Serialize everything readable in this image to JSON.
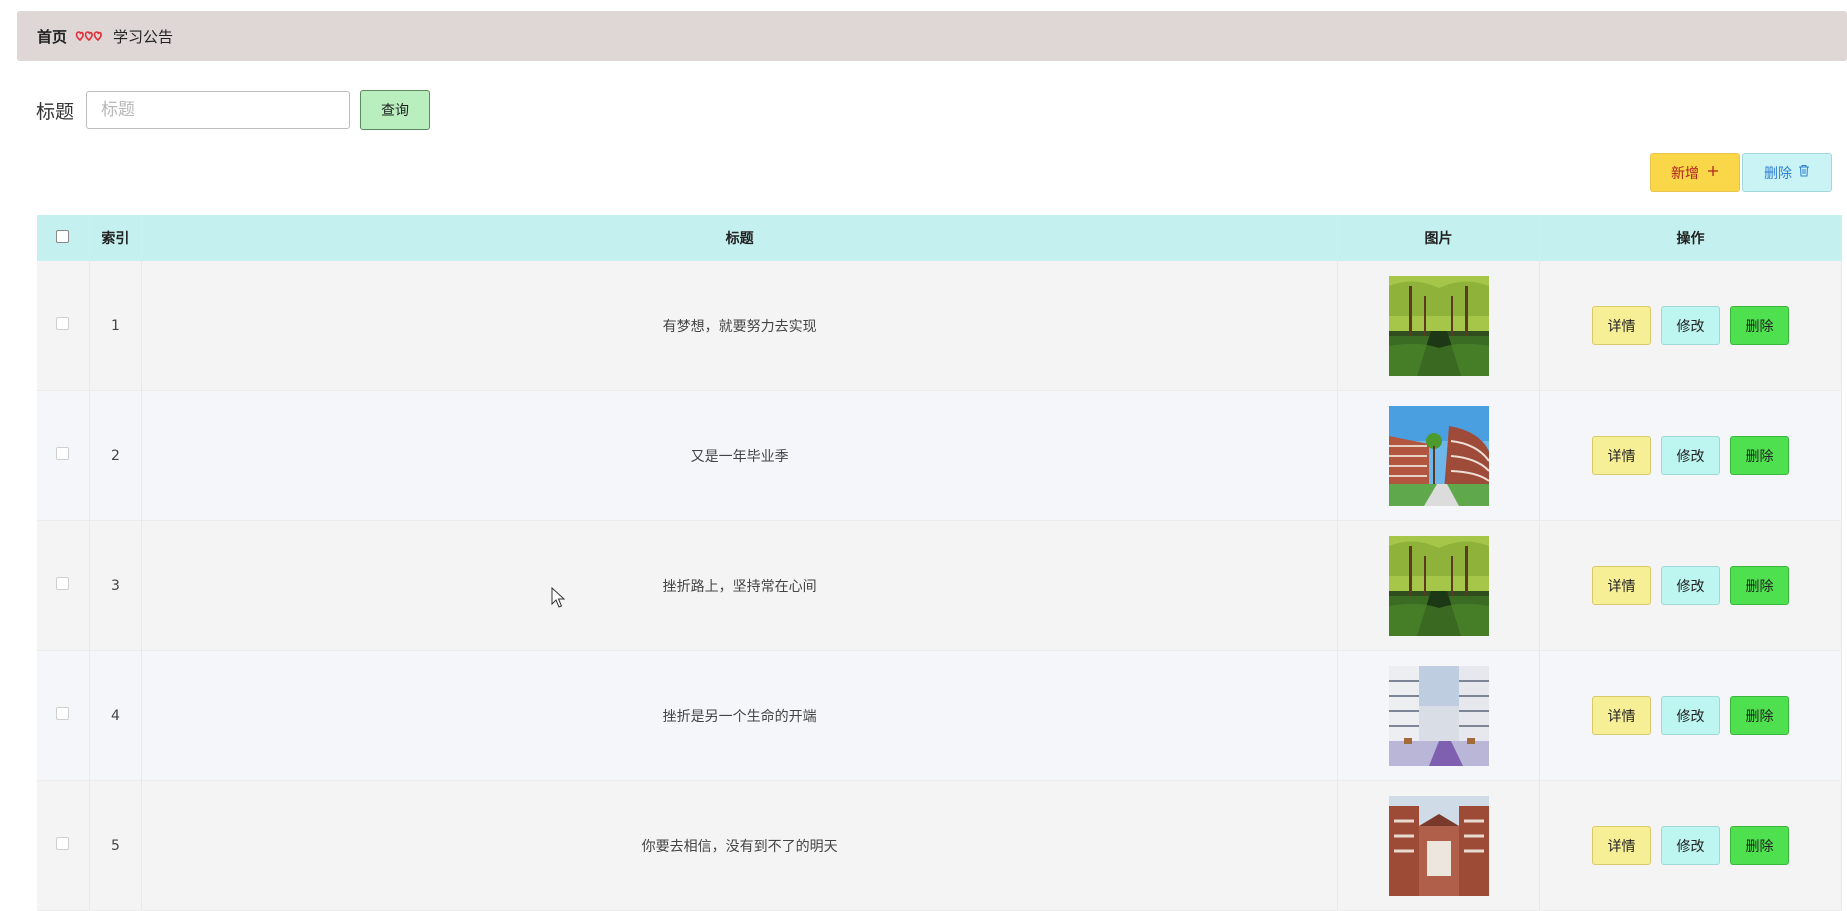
{
  "breadcrumb": {
    "home": "首页",
    "separator_icon": "heart-triple-icon",
    "current": "学习公告"
  },
  "search": {
    "label": "标题",
    "placeholder": "标题",
    "value": "",
    "button_label": "查询"
  },
  "toolbar": {
    "add_label": "新增",
    "add_icon": "plus-icon",
    "delete_label": "删除",
    "delete_icon": "trash-icon"
  },
  "table": {
    "headers": {
      "index": "索引",
      "title": "标题",
      "image": "图片",
      "ops": "操作"
    },
    "rows": [
      {
        "index": "1",
        "title": "有梦想，就要努力去实现",
        "image_scene": "green-tree-avenue"
      },
      {
        "index": "2",
        "title": "又是一年毕业季",
        "image_scene": "campus-building-courtyard"
      },
      {
        "index": "3",
        "title": "挫折路上，坚持常在心间",
        "image_scene": "green-tree-avenue"
      },
      {
        "index": "4",
        "title": "挫折是另一个生命的开端",
        "image_scene": "modern-building-courtyard"
      },
      {
        "index": "5",
        "title": "你要去相信，没有到不了的明天",
        "image_scene": "red-brick-campus"
      }
    ],
    "ops": {
      "detail": "详情",
      "edit": "修改",
      "delete": "删除"
    }
  },
  "colors": {
    "breadcrumb_bg": "#dfd6d6",
    "header_bg": "#c4f0ef",
    "link_blue": "#2f86d6",
    "add_bg": "#f9d749",
    "detail_bg": "#f7ef96",
    "edit_bg": "#bdf5f0",
    "delete_bg": "#4ee04e",
    "search_btn_bg": "#b9efbf"
  }
}
